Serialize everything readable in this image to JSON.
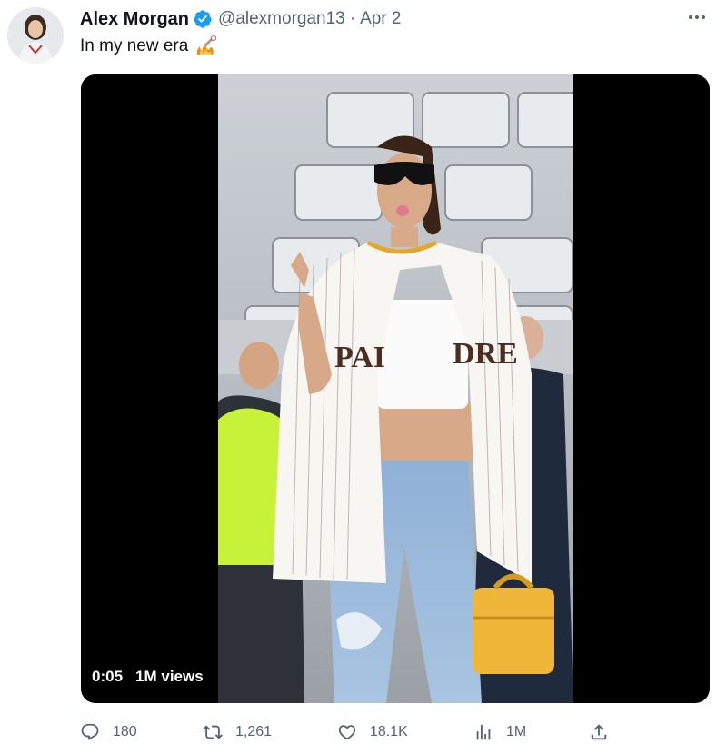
{
  "author": {
    "name": "Alex Morgan",
    "handle": "@alexmorgan13",
    "separator": "·",
    "date": "Apr 2",
    "verified": true
  },
  "tweet": {
    "text": "In my new era",
    "emoji": "fire-baseball-emoji"
  },
  "media": {
    "type": "video",
    "duration": "0:05",
    "views": "1M views"
  },
  "actions": {
    "replies": "180",
    "retweets": "1,261",
    "likes": "18.1K",
    "views": "1M"
  },
  "colors": {
    "verified": "#1d9bf0",
    "secondary_text": "#536471",
    "primary_text": "#0f1419"
  }
}
